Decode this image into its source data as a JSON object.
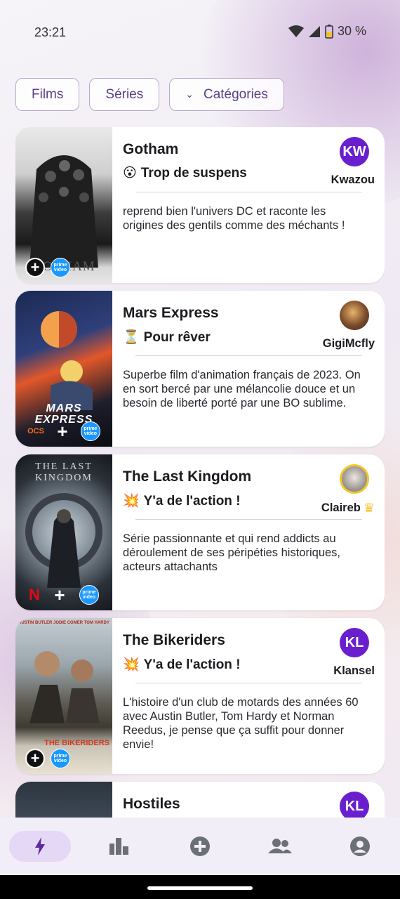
{
  "status_bar": {
    "time": "23:21",
    "battery": "30 %"
  },
  "filters": [
    {
      "label": "Films"
    },
    {
      "label": "Séries"
    },
    {
      "label": "Catégories",
      "icon": "chevron-down-icon"
    }
  ],
  "cards": [
    {
      "title": "Gotham",
      "mood_emoji": "😮",
      "mood": "Trop de suspens",
      "review": "reprend bien l'univers DC et raconte les origines des gentils comme des méchants !",
      "user": "Kwazou",
      "avatar_initials": "KW",
      "poster_text": "GOTHAM",
      "platforms": [
        "add",
        "prime video"
      ]
    },
    {
      "title": "Mars Express",
      "mood_emoji": "⏳",
      "mood": "Pour rêver",
      "review": "Superbe film d'animation français de 2023. On en sort bercé par une mélancolie douce et un besoin de liberté porté par une BO sublime.",
      "user": "GigiMcfly",
      "avatar_initials": "",
      "poster_text": "MARS EXPRESS",
      "platforms": [
        "ocs",
        "add",
        "prime video"
      ]
    },
    {
      "title": "The Last Kingdom",
      "mood_emoji": "💥",
      "mood": "Y'a de l'action !",
      "review": "Série passionnante et qui rend addicts au déroulement de ses péripéties historiques, acteurs attachants",
      "user": "Claireb",
      "avatar_initials": "",
      "poster_text": "THE LAST KINGDOM",
      "platforms": [
        "netflix",
        "add",
        "prime video"
      ]
    },
    {
      "title": "The Bikeriders",
      "mood_emoji": "💥",
      "mood": "Y'a de l'action !",
      "review": "L'histoire d'un club de motards des années 60 avec Austin Butler, Tom  Hardy et Norman Reedus, je pense que ça suffit pour donner envie!",
      "user": "Klansel",
      "avatar_initials": "KL",
      "poster_text": "THE BIKERIDERS",
      "poster_names": "AUSTIN BUTLER   JODIE COMER   TOM HARDY",
      "platforms": [
        "add",
        "prime video"
      ]
    },
    {
      "title": "Hostiles",
      "avatar_initials": "KL"
    }
  ],
  "bottom_nav": [
    {
      "icon": "bolt-icon",
      "active": true
    },
    {
      "icon": "bar-chart-icon"
    },
    {
      "icon": "add-circle-icon"
    },
    {
      "icon": "group-icon"
    },
    {
      "icon": "account-icon"
    }
  ],
  "colors": {
    "accent": "#6a1fcf",
    "chip_border": "#b9a7cf",
    "nav_active": "#e5d8f6"
  }
}
